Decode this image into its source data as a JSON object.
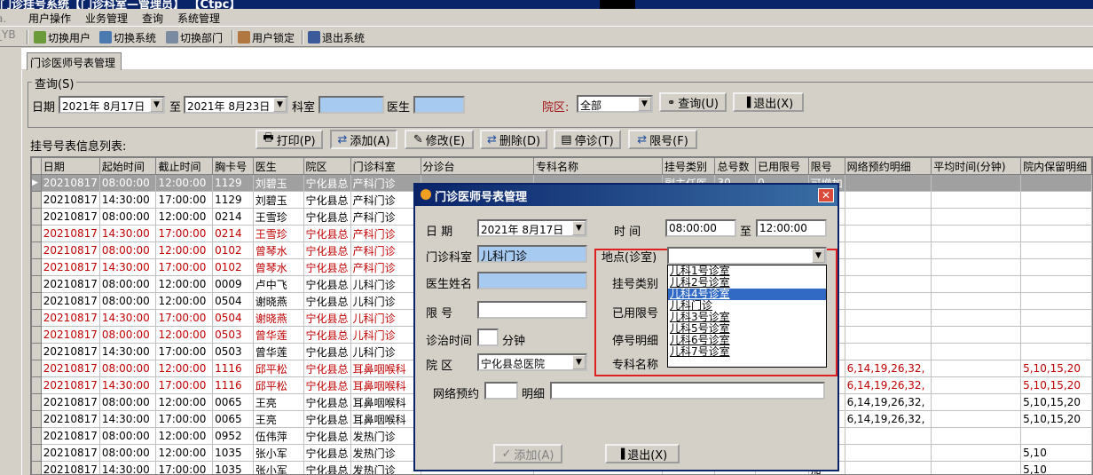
{
  "window": {
    "title": "门诊挂号系统【门诊科室—管理员】 【Ctpc】"
  },
  "menu": [
    "用户操作",
    "业务管理",
    "查询",
    "系统管理"
  ],
  "toolbar": {
    "switch_user": "切换用户",
    "switch_system": "切换系统",
    "switch_dept": "切换部门",
    "lock_user": "用户锁定",
    "exit_system": "退出系统"
  },
  "left_edge": {
    "l1": "a.",
    "l2": "_YB"
  },
  "tab": {
    "label": "门诊医师号表管理"
  },
  "query": {
    "group_title": "查询(S)",
    "date_label": "日期",
    "date_from": "2021年 8月17日",
    "to_label": "至",
    "date_to": "2021年 8月23日",
    "dept_label": "科室",
    "doctor_label": "医生",
    "campus_label": "院区:",
    "campus_value": "全部",
    "query_button": "查询(U)",
    "exit_button": "退出(X)"
  },
  "list": {
    "label": "挂号号表信息列表:",
    "print": "打印(P)",
    "add": "添加(A)",
    "edit": "修改(E)",
    "delete": "删除(D)",
    "suspend": "停诊(T)",
    "limit": "限号(F)"
  },
  "table": {
    "columns": [
      "日期",
      "起始时间",
      "截止时间",
      "胸卡号",
      "医生",
      "院区",
      "门诊科室",
      "分诊台",
      "专科名称",
      "挂号类别",
      "总号数",
      "已用限号",
      "限号",
      "网络预约明细",
      "平均时间(分钟)",
      "院内保留明细"
    ],
    "rows": [
      {
        "red": true,
        "sel": true,
        "c": [
          "20210817",
          "08:00:00",
          "12:00:00",
          "1129",
          "刘碧玉",
          "宁化县总",
          "产科门诊",
          "",
          "",
          "副主任医",
          "30",
          "0",
          "可增加",
          "",
          "",
          ""
        ]
      },
      {
        "red": false,
        "sel": false,
        "c": [
          "20210817",
          "14:30:00",
          "17:00:00",
          "1129",
          "刘碧玉",
          "宁化县总",
          "产科门诊",
          "",
          "",
          "",
          "",
          "",
          "加",
          "",
          "",
          ""
        ]
      },
      {
        "red": false,
        "sel": false,
        "c": [
          "20210817",
          "08:00:00",
          "12:00:00",
          "0214",
          "王雪珍",
          "宁化县总",
          "产科门诊",
          "",
          "",
          "",
          "",
          "",
          "加",
          "",
          "",
          ""
        ]
      },
      {
        "red": true,
        "sel": false,
        "c": [
          "20210817",
          "14:30:00",
          "17:00:00",
          "0214",
          "王雪珍",
          "宁化县总",
          "产科门诊",
          "",
          "",
          "",
          "",
          "",
          "加",
          "",
          "",
          ""
        ]
      },
      {
        "red": true,
        "sel": false,
        "c": [
          "20210817",
          "08:00:00",
          "12:00:00",
          "0102",
          "曾琴水",
          "宁化县总",
          "产科门诊",
          "",
          "",
          "",
          "",
          "",
          "加",
          "",
          "",
          ""
        ]
      },
      {
        "red": true,
        "sel": false,
        "c": [
          "20210817",
          "14:30:00",
          "17:00:00",
          "0102",
          "曾琴水",
          "宁化县总",
          "产科门诊",
          "",
          "",
          "",
          "",
          "",
          "加",
          "",
          "",
          ""
        ]
      },
      {
        "red": false,
        "sel": false,
        "c": [
          "20210817",
          "08:00:00",
          "12:00:00",
          "0009",
          "卢中飞",
          "宁化县总",
          "儿科门诊",
          "",
          "",
          "",
          "",
          "",
          "加",
          "",
          "",
          ""
        ]
      },
      {
        "red": false,
        "sel": false,
        "c": [
          "20210817",
          "08:00:00",
          "12:00:00",
          "0504",
          "谢晓燕",
          "宁化县总",
          "儿科门诊",
          "",
          "",
          "",
          "",
          "",
          "加",
          "",
          "",
          ""
        ]
      },
      {
        "red": true,
        "sel": false,
        "c": [
          "20210817",
          "14:30:00",
          "17:00:00",
          "0504",
          "谢晓燕",
          "宁化县总",
          "儿科门诊",
          "",
          "",
          "",
          "",
          "",
          "加",
          "",
          "",
          ""
        ]
      },
      {
        "red": true,
        "sel": false,
        "c": [
          "20210817",
          "08:00:00",
          "12:00:00",
          "0503",
          "曾华莲",
          "宁化县总",
          "儿科门诊",
          "",
          "",
          "",
          "",
          "",
          "加",
          "",
          "",
          ""
        ]
      },
      {
        "red": false,
        "sel": false,
        "c": [
          "20210817",
          "14:30:00",
          "17:00:00",
          "0503",
          "曾华莲",
          "宁化县总",
          "儿科门诊",
          "",
          "",
          "",
          "",
          "",
          "加",
          "",
          "",
          ""
        ]
      },
      {
        "red": true,
        "sel": false,
        "c": [
          "20210817",
          "08:00:00",
          "12:00:00",
          "1116",
          "邱平松",
          "宁化县总",
          "耳鼻咽喉科",
          "",
          "",
          "",
          "",
          "",
          "加",
          "6,14,19,26,32,",
          "",
          "5,10,15,20"
        ]
      },
      {
        "red": true,
        "sel": false,
        "c": [
          "20210817",
          "14:30:00",
          "17:00:00",
          "1116",
          "邱平松",
          "宁化县总",
          "耳鼻咽喉科",
          "",
          "",
          "",
          "",
          "",
          "加",
          "6,14,19,26,32,",
          "",
          "5,10,15,20"
        ]
      },
      {
        "red": false,
        "sel": false,
        "c": [
          "20210817",
          "08:00:00",
          "12:00:00",
          "0065",
          "王亮",
          "宁化县总",
          "耳鼻咽喉科",
          "",
          "",
          "",
          "",
          "",
          "加",
          "6,14,19,26,32,",
          "",
          "5,10,15,20"
        ]
      },
      {
        "red": false,
        "sel": false,
        "c": [
          "20210817",
          "14:30:00",
          "17:00:00",
          "0065",
          "王亮",
          "宁化县总",
          "耳鼻咽喉科",
          "",
          "",
          "",
          "",
          "",
          "加",
          "6,14,19,26,32,",
          "",
          "5,10,15,20"
        ]
      },
      {
        "red": false,
        "sel": false,
        "c": [
          "20210817",
          "08:00:00",
          "12:00:00",
          "0952",
          "伍伟萍",
          "宁化县总",
          "发热门诊",
          "",
          "",
          "",
          "",
          "",
          "加",
          "",
          "",
          ""
        ]
      },
      {
        "red": false,
        "sel": false,
        "c": [
          "20210817",
          "08:00:00",
          "12:00:00",
          "1035",
          "张小军",
          "宁化县总",
          "发热门诊",
          "",
          "",
          "",
          "",
          "",
          "加",
          "",
          "",
          "5,10"
        ]
      },
      {
        "red": false,
        "sel": false,
        "c": [
          "20210817",
          "14:30:00",
          "17:00:00",
          "1035",
          "张小军",
          "宁化县总",
          "发热门诊",
          "",
          "",
          "",
          "",
          "",
          "加",
          "",
          "",
          "5,10"
        ]
      }
    ]
  },
  "dialog": {
    "title": "门诊医师号表管理",
    "date_label": "日  期",
    "date_value": "2021年 8月17日",
    "time_label": "时  间",
    "time_from": "08:00:00",
    "time_to_label": "至",
    "time_to": "12:00:00",
    "dept_label": "门诊科室",
    "dept_value": "儿科门诊",
    "doctor_label": "医生姓名",
    "limit_label": "限  号",
    "duration_label": "诊治时间",
    "minutes_label": "分钟",
    "campus_label": "院  区",
    "campus_value": "宁化县总医院",
    "location_label": "地点(诊室)",
    "reg_type_label": "挂号类别",
    "used_limit_label": "已用限号",
    "stop_detail_label": "停号明细",
    "specialty_label": "专科名称",
    "net_label": "网络预约",
    "detail_label": "明细",
    "add_button": "添加(A)",
    "exit_button": "退出(X)",
    "location_options": [
      "儿科1号诊室",
      "儿科2号诊室",
      "儿科4号诊室",
      "儿科门诊",
      "儿科3号诊室",
      "儿科5号诊室",
      "儿科6号诊室",
      "儿科7号诊室"
    ],
    "location_selected_index": 2
  }
}
